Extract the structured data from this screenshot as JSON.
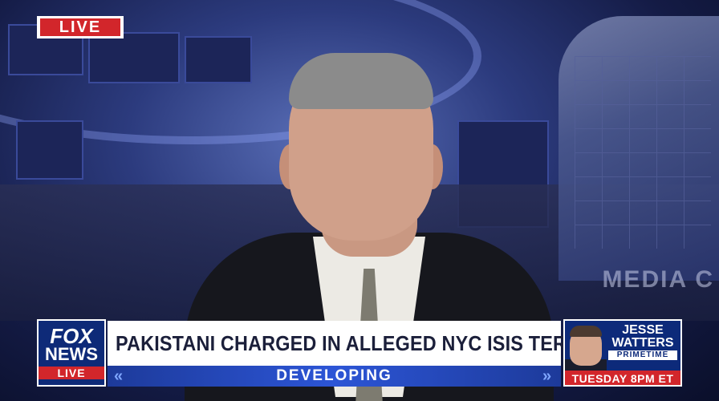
{
  "live_bug": {
    "label": "LIVE",
    "accent": "#d2262b"
  },
  "logo": {
    "line1": "FOX",
    "line2": "NEWS",
    "live": "LIVE"
  },
  "lower_third": {
    "headline": "PAKISTANI CHARGED IN ALLEGED NYC ISIS TERROR PLOT",
    "tag": "DEVELOPING",
    "tag_color": "#2c55d6"
  },
  "promo": {
    "line1": "JESSE",
    "line2": "WATTERS",
    "line3": "PRIMETIME",
    "schedule": "TUESDAY 8PM ET"
  },
  "background": {
    "sign_text": "MEDIA C"
  }
}
